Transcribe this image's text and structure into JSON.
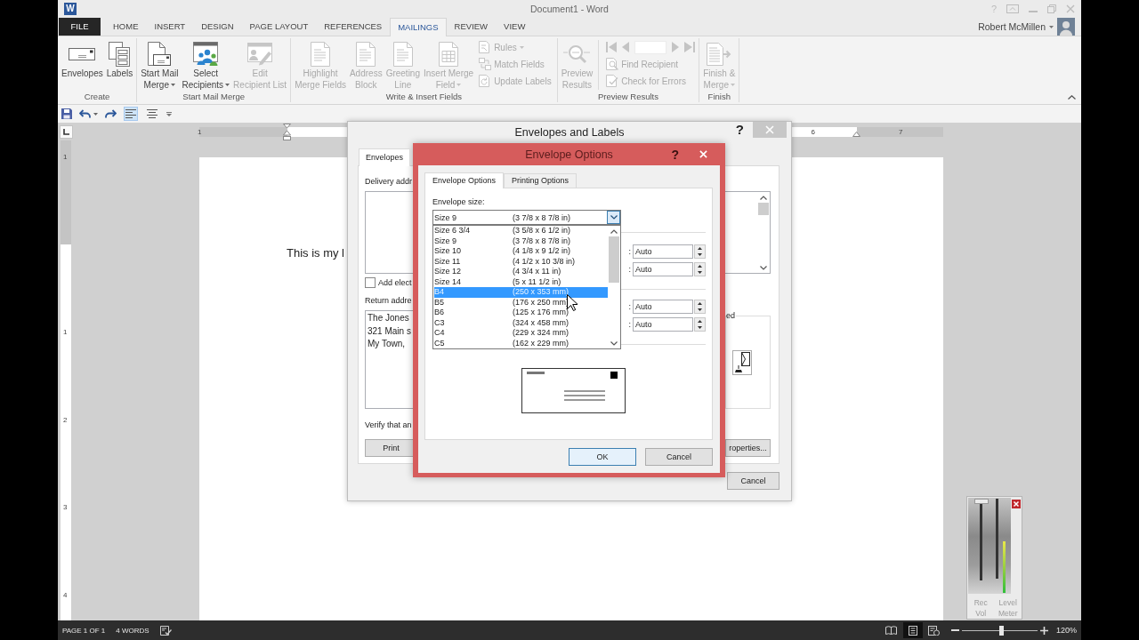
{
  "window": {
    "logo": "W",
    "title": "Document1 - Word",
    "help": "?"
  },
  "ribbon_tabs": [
    {
      "label": "FILE",
      "kind": "backstage",
      "selected": false
    },
    {
      "label": "HOME",
      "kind": "tab",
      "selected": false
    },
    {
      "label": "INSERT",
      "kind": "tab",
      "selected": false
    },
    {
      "label": "DESIGN",
      "kind": "tab",
      "selected": false
    },
    {
      "label": "PAGE LAYOUT",
      "kind": "tab",
      "selected": false
    },
    {
      "label": "REFERENCES",
      "kind": "tab",
      "selected": false
    },
    {
      "label": "MAILINGS",
      "kind": "tab",
      "selected": true
    },
    {
      "label": "REVIEW",
      "kind": "tab",
      "selected": false
    },
    {
      "label": "VIEW",
      "kind": "tab",
      "selected": false
    }
  ],
  "account": {
    "name": "Robert McMillen"
  },
  "ribbon_groups": [
    {
      "label": "Create",
      "large": [
        {
          "label": "Envelopes",
          "disabled": false,
          "dropdown": false
        },
        {
          "label": "Labels",
          "disabled": false,
          "dropdown": false
        }
      ]
    },
    {
      "label": "Start Mail Merge",
      "large": [
        {
          "label": "Start Mail\nMerge",
          "disabled": false,
          "dropdown": true
        },
        {
          "label": "Select\nRecipients",
          "disabled": false,
          "dropdown": true
        },
        {
          "label": "Edit\nRecipient List",
          "disabled": true,
          "dropdown": false
        }
      ]
    },
    {
      "label": "Write & Insert Fields",
      "large": [
        {
          "label": "Highlight\nMerge Fields",
          "disabled": true,
          "dropdown": false
        },
        {
          "label": "Address\nBlock",
          "disabled": true,
          "dropdown": false
        },
        {
          "label": "Greeting\nLine",
          "disabled": true,
          "dropdown": false
        },
        {
          "label": "Insert Merge\nField",
          "disabled": true,
          "dropdown": true
        }
      ],
      "small": [
        {
          "label": "Rules",
          "disabled": true,
          "dropdown": true
        },
        {
          "label": "Match Fields",
          "disabled": true,
          "dropdown": false
        },
        {
          "label": "Update Labels",
          "disabled": true,
          "dropdown": false
        }
      ]
    },
    {
      "label": "Preview Results",
      "large": [
        {
          "label": "Preview\nResults",
          "disabled": true,
          "dropdown": false
        }
      ],
      "navigator": {
        "disabled": true
      },
      "small": [
        {
          "label": "Find Recipient",
          "disabled": true,
          "dropdown": false
        },
        {
          "label": "Check for Errors",
          "disabled": true,
          "dropdown": false
        }
      ]
    },
    {
      "label": "Finish",
      "large": [
        {
          "label": "Finish &\nMerge",
          "disabled": true,
          "dropdown": true
        }
      ]
    }
  ],
  "quick_access": {
    "alignment": [
      {
        "selected": true
      },
      {
        "selected": false
      }
    ]
  },
  "ruler": {
    "horizontal": [
      "1",
      "6",
      "7"
    ],
    "vertical": [
      "1",
      "1",
      "2",
      "3",
      "4"
    ]
  },
  "document": {
    "text": "This is my l"
  },
  "status_bar": {
    "page": "PAGE 1 OF 1",
    "words": "4 WORDS",
    "views": [
      {
        "selected": false
      },
      {
        "selected": true
      },
      {
        "selected": false
      }
    ],
    "zoom": {
      "level": 0.53,
      "reading": "120%"
    }
  },
  "envelopes_dialog": {
    "title": "Envelopes and Labels",
    "help": "?",
    "tabs": [
      {
        "label": "Envelopes",
        "selected": true
      }
    ],
    "delivery_label": "Delivery addr",
    "electronic_postage": {
      "label": "Add elect",
      "checked": false
    },
    "return_label": "Return addre",
    "return_address": [
      "The Jones",
      "321 Main s",
      "My Town,"
    ],
    "verify_text": "Verify that an",
    "feed_label": "ed",
    "buttons": {
      "print": "Print",
      "properties": "roperties...",
      "cancel": "Cancel"
    }
  },
  "envelope_options": {
    "title": "Envelope Options",
    "help": "?",
    "tabs": [
      {
        "label": "Envelope Options",
        "selected": true
      },
      {
        "label": "Printing Options",
        "selected": false
      }
    ],
    "size_label": "Envelope size:",
    "size_combo": {
      "name": "Size 9",
      "dims": "(3 7/8 x 8 7/8 in)",
      "open": true
    },
    "size_list": [
      {
        "name": "Size 6 3/4",
        "dims": "(3 5/8 x 6 1/2 in)",
        "selected": false
      },
      {
        "name": "Size 9",
        "dims": "(3 7/8 x 8 7/8 in)",
        "selected": false
      },
      {
        "name": "Size 10",
        "dims": "(4 1/8 x 9 1/2 in)",
        "selected": false
      },
      {
        "name": "Size 11",
        "dims": "(4 1/2 x 10 3/8 in)",
        "selected": false
      },
      {
        "name": "Size 12",
        "dims": "(4 3/4 x 11 in)",
        "selected": false
      },
      {
        "name": "Size 14",
        "dims": "(5 x 11 1/2 in)",
        "selected": false
      },
      {
        "name": "B4",
        "dims": "(250 x 353 mm)",
        "selected": true
      },
      {
        "name": "B5",
        "dims": "(176 x 250 mm)",
        "selected": false
      },
      {
        "name": "B6",
        "dims": "(125 x 176 mm)",
        "selected": false
      },
      {
        "name": "C3",
        "dims": "(324 x 458 mm)",
        "selected": false
      },
      {
        "name": "C4",
        "dims": "(229 x 324 mm)",
        "selected": false
      },
      {
        "name": "C5",
        "dims": "(162 x 229 mm)",
        "selected": false
      }
    ],
    "position_fields": [
      {
        "label": ":",
        "value": "Auto"
      },
      {
        "label": ":",
        "value": "Auto"
      },
      {
        "label": ":",
        "value": "Auto"
      },
      {
        "label": ":",
        "value": "Auto"
      }
    ],
    "buttons": [
      {
        "label": "OK",
        "default": true
      },
      {
        "label": "Cancel",
        "default": false
      }
    ]
  },
  "level_meter": {
    "controls": [
      {
        "kind": "slider",
        "label": "Rec\nVol",
        "level": 1.0
      },
      {
        "kind": "meter",
        "label": "Level\nMeter",
        "level": 0.55
      }
    ]
  }
}
